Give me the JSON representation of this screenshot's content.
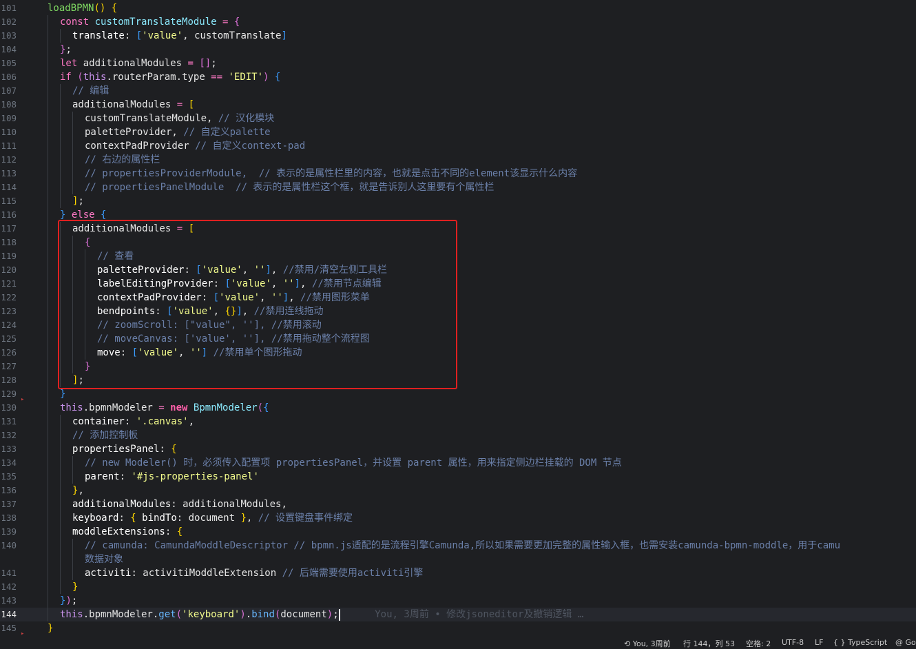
{
  "lines": [
    {
      "n": "101",
      "guides": [],
      "tokens": [
        [
          "fn",
          "loadBPMN"
        ],
        [
          "p1",
          "()"
        ],
        [
          "var",
          " "
        ],
        [
          "p1",
          "{"
        ]
      ]
    },
    {
      "n": "102",
      "guides": [
        1
      ],
      "tokens": [
        [
          "kw",
          "const"
        ],
        [
          "var",
          " "
        ],
        [
          "cls",
          "customTranslateModule"
        ],
        [
          "var",
          " "
        ],
        [
          "op",
          "="
        ],
        [
          "var",
          " "
        ],
        [
          "p2",
          "{"
        ]
      ]
    },
    {
      "n": "103",
      "guides": [
        1,
        2
      ],
      "tokens": [
        [
          "prop",
          "translate"
        ],
        [
          "var",
          ": "
        ],
        [
          "p3",
          "["
        ],
        [
          "str",
          "'value'"
        ],
        [
          "var",
          ", customTranslate"
        ],
        [
          "p3",
          "]"
        ]
      ]
    },
    {
      "n": "104",
      "guides": [
        1
      ],
      "tokens": [
        [
          "p2",
          "}"
        ],
        [
          "var",
          ";"
        ]
      ]
    },
    {
      "n": "105",
      "guides": [
        1
      ],
      "tokens": [
        [
          "kw",
          "let"
        ],
        [
          "var",
          " additionalModules "
        ],
        [
          "op",
          "="
        ],
        [
          "var",
          " "
        ],
        [
          "p2",
          "[]"
        ],
        [
          "var",
          ";"
        ]
      ]
    },
    {
      "n": "106",
      "guides": [
        1
      ],
      "tokens": [
        [
          "kw",
          "if"
        ],
        [
          "var",
          " "
        ],
        [
          "p2",
          "("
        ],
        [
          "this",
          "this"
        ],
        [
          "var",
          ".routerParam.type "
        ],
        [
          "op",
          "=="
        ],
        [
          "var",
          " "
        ],
        [
          "str",
          "'EDIT'"
        ],
        [
          "p2",
          ")"
        ],
        [
          "var",
          " "
        ],
        [
          "p3",
          "{"
        ]
      ]
    },
    {
      "n": "107",
      "guides": [
        1,
        2
      ],
      "tokens": [
        [
          "cm",
          "// 编辑"
        ]
      ]
    },
    {
      "n": "108",
      "guides": [
        1,
        2
      ],
      "tokens": [
        [
          "var",
          "additionalModules "
        ],
        [
          "op",
          "="
        ],
        [
          "var",
          " "
        ],
        [
          "p1",
          "["
        ]
      ]
    },
    {
      "n": "109",
      "guides": [
        1,
        2,
        3
      ],
      "tokens": [
        [
          "var",
          "customTranslateModule, "
        ],
        [
          "cm",
          "// 汉化模块"
        ]
      ]
    },
    {
      "n": "110",
      "guides": [
        1,
        2,
        3
      ],
      "tokens": [
        [
          "var",
          "paletteProvider, "
        ],
        [
          "cm",
          "// 自定义palette"
        ]
      ]
    },
    {
      "n": "111",
      "guides": [
        1,
        2,
        3
      ],
      "tokens": [
        [
          "var",
          "contextPadProvider "
        ],
        [
          "cm",
          "// 自定义context-pad"
        ]
      ]
    },
    {
      "n": "112",
      "guides": [
        1,
        2,
        3
      ],
      "tokens": [
        [
          "cm",
          "// 右边的属性栏"
        ]
      ]
    },
    {
      "n": "113",
      "guides": [
        1,
        2,
        3
      ],
      "tokens": [
        [
          "cm",
          "// propertiesProviderModule,  // 表示的是属性栏里的内容，也就是点击不同的element该显示什么内容"
        ]
      ]
    },
    {
      "n": "114",
      "guides": [
        1,
        2,
        3
      ],
      "tokens": [
        [
          "cm",
          "// propertiesPanelModule  // 表示的是属性栏这个框，就是告诉别人这里要有个属性栏"
        ]
      ]
    },
    {
      "n": "115",
      "guides": [
        1,
        2
      ],
      "tokens": [
        [
          "p1",
          "]"
        ],
        [
          "var",
          ";"
        ]
      ]
    },
    {
      "n": "116",
      "guides": [
        1
      ],
      "tokens": [
        [
          "p3",
          "}"
        ],
        [
          "var",
          " "
        ],
        [
          "kw",
          "else"
        ],
        [
          "var",
          " "
        ],
        [
          "p3",
          "{"
        ]
      ]
    },
    {
      "n": "117",
      "guides": [
        1,
        2
      ],
      "tokens": [
        [
          "var",
          "additionalModules "
        ],
        [
          "op",
          "="
        ],
        [
          "var",
          " "
        ],
        [
          "p1",
          "["
        ]
      ]
    },
    {
      "n": "118",
      "guides": [
        1,
        2,
        3
      ],
      "tokens": [
        [
          "p2",
          "{"
        ]
      ]
    },
    {
      "n": "119",
      "guides": [
        1,
        2,
        3,
        4
      ],
      "tokens": [
        [
          "cm",
          "// 查看"
        ]
      ]
    },
    {
      "n": "120",
      "guides": [
        1,
        2,
        3,
        4
      ],
      "tokens": [
        [
          "prop",
          "paletteProvider"
        ],
        [
          "var",
          ": "
        ],
        [
          "p3",
          "["
        ],
        [
          "str",
          "'value'"
        ],
        [
          "var",
          ", "
        ],
        [
          "str",
          "''"
        ],
        [
          "p3",
          "]"
        ],
        [
          "var",
          ", "
        ],
        [
          "cm",
          "//禁用/清空左侧工具栏"
        ]
      ]
    },
    {
      "n": "121",
      "guides": [
        1,
        2,
        3,
        4
      ],
      "tokens": [
        [
          "prop",
          "labelEditingProvider"
        ],
        [
          "var",
          ": "
        ],
        [
          "p3",
          "["
        ],
        [
          "str",
          "'value'"
        ],
        [
          "var",
          ", "
        ],
        [
          "str",
          "''"
        ],
        [
          "p3",
          "]"
        ],
        [
          "var",
          ", "
        ],
        [
          "cm",
          "//禁用节点编辑"
        ]
      ]
    },
    {
      "n": "122",
      "guides": [
        1,
        2,
        3,
        4
      ],
      "tokens": [
        [
          "prop",
          "contextPadProvider"
        ],
        [
          "var",
          ": "
        ],
        [
          "p3",
          "["
        ],
        [
          "str",
          "'value'"
        ],
        [
          "var",
          ", "
        ],
        [
          "str",
          "''"
        ],
        [
          "p3",
          "]"
        ],
        [
          "var",
          ", "
        ],
        [
          "cm",
          "//禁用图形菜单"
        ]
      ]
    },
    {
      "n": "123",
      "guides": [
        1,
        2,
        3,
        4
      ],
      "tokens": [
        [
          "prop",
          "bendpoints"
        ],
        [
          "var",
          ": "
        ],
        [
          "p3",
          "["
        ],
        [
          "str",
          "'value'"
        ],
        [
          "var",
          ", "
        ],
        [
          "p1",
          "{}"
        ],
        [
          "p3",
          "]"
        ],
        [
          "var",
          ", "
        ],
        [
          "cm",
          "//禁用连线拖动"
        ]
      ]
    },
    {
      "n": "124",
      "guides": [
        1,
        2,
        3,
        4
      ],
      "tokens": [
        [
          "cm",
          "// zoomScroll: [\"value\", ''], //禁用滚动"
        ]
      ]
    },
    {
      "n": "125",
      "guides": [
        1,
        2,
        3,
        4
      ],
      "tokens": [
        [
          "cm",
          "// moveCanvas: ['value', ''], //禁用拖动整个流程图"
        ]
      ]
    },
    {
      "n": "126",
      "guides": [
        1,
        2,
        3,
        4
      ],
      "tokens": [
        [
          "prop",
          "move"
        ],
        [
          "var",
          ": "
        ],
        [
          "p3",
          "["
        ],
        [
          "str",
          "'value'"
        ],
        [
          "var",
          ", "
        ],
        [
          "str",
          "''"
        ],
        [
          "p3",
          "]"
        ],
        [
          "var",
          " "
        ],
        [
          "cm",
          "//禁用单个图形拖动"
        ]
      ]
    },
    {
      "n": "127",
      "guides": [
        1,
        2,
        3
      ],
      "tokens": [
        [
          "p2",
          "}"
        ]
      ]
    },
    {
      "n": "128",
      "guides": [
        1,
        2
      ],
      "tokens": [
        [
          "p1",
          "]"
        ],
        [
          "var",
          ";"
        ]
      ]
    },
    {
      "n": "129",
      "guides": [
        1
      ],
      "tokens": [
        [
          "p3",
          "}"
        ]
      ]
    },
    {
      "n": "130",
      "guides": [
        1
      ],
      "tokens": [
        [
          "this",
          "this"
        ],
        [
          "var",
          ".bpmnModeler "
        ],
        [
          "op",
          "="
        ],
        [
          "var",
          " "
        ],
        [
          "kwb",
          "new"
        ],
        [
          "var",
          " "
        ],
        [
          "cls",
          "BpmnModeler"
        ],
        [
          "p2",
          "("
        ],
        [
          "p3",
          "{"
        ]
      ]
    },
    {
      "n": "131",
      "guides": [
        1,
        2
      ],
      "tokens": [
        [
          "prop",
          "container"
        ],
        [
          "var",
          ": "
        ],
        [
          "str",
          "'.canvas'"
        ],
        [
          "var",
          ","
        ]
      ]
    },
    {
      "n": "132",
      "guides": [
        1,
        2
      ],
      "tokens": [
        [
          "cm",
          "// 添加控制板"
        ]
      ]
    },
    {
      "n": "133",
      "guides": [
        1,
        2
      ],
      "tokens": [
        [
          "prop",
          "propertiesPanel"
        ],
        [
          "var",
          ": "
        ],
        [
          "p1",
          "{"
        ]
      ]
    },
    {
      "n": "134",
      "guides": [
        1,
        2,
        3
      ],
      "tokens": [
        [
          "cm",
          "// new Modeler() 时，必须传入配置项 propertiesPanel，并设置 parent 属性，用来指定侧边栏挂载的 DOM 节点"
        ]
      ]
    },
    {
      "n": "135",
      "guides": [
        1,
        2,
        3
      ],
      "tokens": [
        [
          "prop",
          "parent"
        ],
        [
          "var",
          ": "
        ],
        [
          "str",
          "'#js-properties-panel'"
        ]
      ]
    },
    {
      "n": "136",
      "guides": [
        1,
        2
      ],
      "tokens": [
        [
          "p1",
          "}"
        ],
        [
          "var",
          ","
        ]
      ]
    },
    {
      "n": "137",
      "guides": [
        1,
        2
      ],
      "tokens": [
        [
          "prop",
          "additionalModules"
        ],
        [
          "var",
          ": additionalModules,"
        ]
      ]
    },
    {
      "n": "138",
      "guides": [
        1,
        2
      ],
      "tokens": [
        [
          "prop",
          "keyboard"
        ],
        [
          "var",
          ": "
        ],
        [
          "p1",
          "{"
        ],
        [
          "var",
          " "
        ],
        [
          "prop",
          "bindTo"
        ],
        [
          "var",
          ": document "
        ],
        [
          "p1",
          "}"
        ],
        [
          "var",
          ", "
        ],
        [
          "cm",
          "// 设置键盘事件绑定"
        ]
      ]
    },
    {
      "n": "139",
      "guides": [
        1,
        2
      ],
      "tokens": [
        [
          "prop",
          "moddleExtensions"
        ],
        [
          "var",
          ": "
        ],
        [
          "p1",
          "{"
        ]
      ]
    },
    {
      "n": "140",
      "guides": [
        1,
        2,
        3
      ],
      "tokens": [
        [
          "cm",
          "// camunda: CamundaModdleDescriptor // bpmn.js适配的是流程引擎Camunda,所以如果需要更加完整的属性输入框，也需安装camunda-bpmn-moddle，用于camu"
        ]
      ]
    },
    {
      "n": "",
      "guides": [
        1,
        2,
        3
      ],
      "tokens": [
        [
          "cm",
          "数据对象"
        ]
      ]
    },
    {
      "n": "141",
      "guides": [
        1,
        2,
        3
      ],
      "tokens": [
        [
          "prop",
          "activiti"
        ],
        [
          "var",
          ": activitiModdleExtension "
        ],
        [
          "cm",
          "// 后端需要使用activiti引擎"
        ]
      ]
    },
    {
      "n": "142",
      "guides": [
        1,
        2
      ],
      "tokens": [
        [
          "p1",
          "}"
        ]
      ]
    },
    {
      "n": "143",
      "guides": [
        1
      ],
      "tokens": [
        [
          "p3",
          "}"
        ],
        [
          "p2",
          ")"
        ],
        [
          "var",
          ";"
        ]
      ]
    },
    {
      "n": "144",
      "guides": [
        1
      ],
      "current": true,
      "tokens": [
        [
          "this",
          "this"
        ],
        [
          "var",
          ".bpmnModeler."
        ],
        [
          "fnb",
          "get"
        ],
        [
          "p2",
          "("
        ],
        [
          "str",
          "'keyboard'"
        ],
        [
          "p2",
          ")"
        ],
        [
          "var",
          "."
        ],
        [
          "fnb",
          "bind"
        ],
        [
          "p2",
          "("
        ],
        [
          "var",
          "document"
        ],
        [
          "p2",
          ")"
        ],
        [
          "var",
          ";"
        ],
        [
          "cursor",
          ""
        ],
        [
          "ghost",
          "      You, 3周前 • 修改jsoneditor及撤销逻辑 …"
        ]
      ]
    },
    {
      "n": "145",
      "guides": [],
      "tokens": [
        [
          "p1",
          "}"
        ]
      ]
    }
  ],
  "statusbar": {
    "blame": "You, 3周前",
    "position": "行 144，列 53",
    "indent": "空格: 2",
    "encoding": "UTF-8",
    "eol": "LF",
    "language": "{ } TypeScript",
    "extra": "@ Go"
  }
}
